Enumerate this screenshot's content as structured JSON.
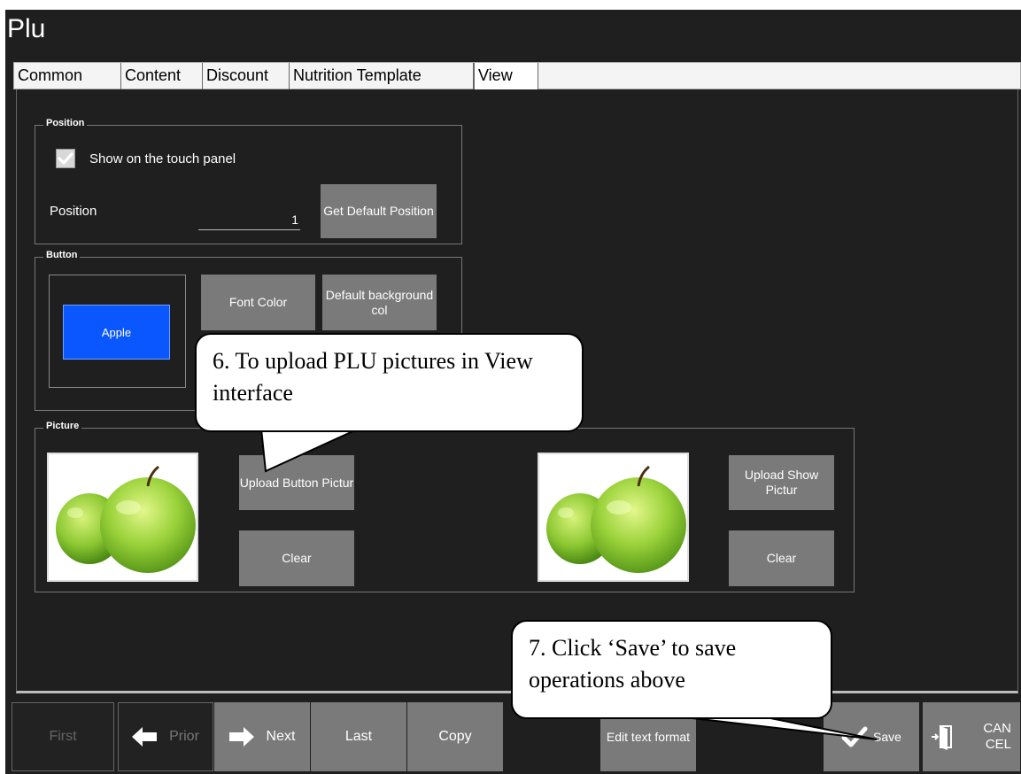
{
  "window": {
    "title": "Plu"
  },
  "tabs": [
    {
      "label": "Common"
    },
    {
      "label": "Content"
    },
    {
      "label": "Discount"
    },
    {
      "label": "Nutrition Template"
    },
    {
      "label": "View"
    }
  ],
  "position_group": {
    "legend": "Position",
    "show_on_touch_panel_label": "Show on the touch panel",
    "show_on_touch_panel_checked": true,
    "position_label": "Position",
    "position_value": "1",
    "get_default_button": "Get Default Position"
  },
  "button_group": {
    "legend": "Button",
    "preview_text": "Apple",
    "preview_color": "#0a56ff",
    "font_color_button": "Font Color",
    "default_bg_button": "Default background col"
  },
  "picture_group": {
    "legend": "Picture",
    "upload_button_picture": "Upload Button Pictur",
    "clear_left": "Clear",
    "upload_show_picture": "Upload Show Pictur",
    "clear_right": "Clear"
  },
  "bottom_nav": {
    "first": "First",
    "prior": "Prior",
    "next": "Next",
    "last": "Last",
    "copy": "Copy",
    "edit_text_format": "Edit text format",
    "save": "Save",
    "cancel": "CAN CEL"
  },
  "callouts": {
    "step6": "6. To upload PLU pictures in View interface",
    "step7": "7. Click ‘Save’ to save operations above"
  }
}
